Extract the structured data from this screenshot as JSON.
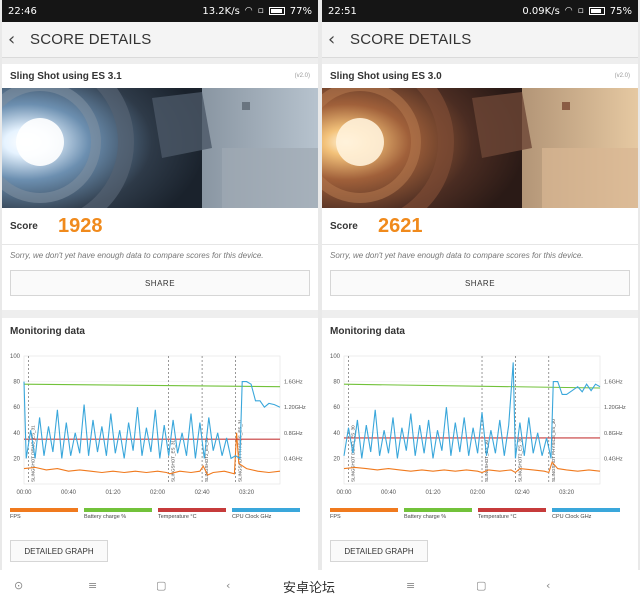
{
  "status_left": {
    "time": "22:46",
    "speed": "13.2K/s",
    "battery_pct": "77%",
    "battery_level": 0.77
  },
  "status_right": {
    "time": "22:51",
    "speed": "0.09K/s",
    "battery_pct": "75%",
    "battery_level": 0.75
  },
  "header": {
    "title": "SCORE DETAILS"
  },
  "panels": [
    {
      "test_name": "Sling Shot using ES 3.1",
      "version": "(v2.0)",
      "score_label": "Score",
      "score": "1928",
      "sorry_text": "Sorry, we don't yet have enough data to compare scores for this device.",
      "share_label": "SHARE",
      "monitoring_title": "Monitoring data",
      "detail_label": "DETAILED GRAPH",
      "phase_labels": [
        "SLINGSHOT DEMO_ES_31",
        "SLINGSHOT_ES_31",
        "SLINGSHOT2_ES_31",
        "SLINGSHOT PHYSICS_ES_31"
      ]
    },
    {
      "test_name": "Sling Shot using ES 3.0",
      "version": "(v2.0)",
      "score_label": "Score",
      "score": "2621",
      "sorry_text": "Sorry, we don't yet have enough data to compare scores for this device.",
      "share_label": "SHARE",
      "monitoring_title": "Monitoring data",
      "detail_label": "DETAILED GRAPH",
      "phase_labels": [
        "SLINGSHOT DEMO_ES_30",
        "SLINGSHOT_ES_30",
        "SLINGSHOT2_ES_30",
        "SLINGSHOT PHYSICS_ES_30"
      ]
    }
  ],
  "chart_data": [
    {
      "type": "line",
      "x_ticks": [
        "00:00",
        "00:40",
        "01:20",
        "02:00",
        "02:40",
        "03:20"
      ],
      "x_range_seconds": [
        0,
        230
      ],
      "y_left_ticks": [
        "100",
        "80",
        "60",
        "40",
        "20"
      ],
      "y_left_range": [
        0,
        100
      ],
      "y_right_ticks": [
        "1.6GHz",
        "1.20GHz",
        "0.8GHz",
        "0.4GHz"
      ],
      "phase_markers_seconds": [
        4,
        130,
        160,
        190
      ],
      "series": [
        {
          "name": "FPS",
          "color": "#f07a1e",
          "points": [
            [
              0,
              12
            ],
            [
              10,
              13
            ],
            [
              20,
              11
            ],
            [
              30,
              12
            ],
            [
              40,
              10
            ],
            [
              50,
              11
            ],
            [
              60,
              10
            ],
            [
              70,
              9
            ],
            [
              80,
              10
            ],
            [
              90,
              9
            ],
            [
              100,
              10
            ],
            [
              110,
              9
            ],
            [
              120,
              10
            ],
            [
              128,
              9
            ],
            [
              131,
              8
            ],
            [
              140,
              10
            ],
            [
              150,
              9
            ],
            [
              158,
              10
            ],
            [
              161,
              14
            ],
            [
              165,
              7
            ],
            [
              170,
              9
            ],
            [
              180,
              10
            ],
            [
              189,
              8
            ],
            [
              191,
              40
            ],
            [
              193,
              16
            ],
            [
              200,
              12
            ],
            [
              210,
              10
            ],
            [
              220,
              9
            ],
            [
              230,
              10
            ]
          ]
        },
        {
          "name": "Battery charge %",
          "color": "#72c23a",
          "points": [
            [
              0,
              78
            ],
            [
              230,
              76
            ]
          ]
        },
        {
          "name": "Temperature °C",
          "color": "#c63b3b",
          "points": [
            [
              0,
              35
            ],
            [
              230,
              35
            ]
          ]
        },
        {
          "name": "CPU Clock GHz",
          "color": "#3aa7db",
          "points": [
            [
              0,
              80
            ],
            [
              2,
              20
            ],
            [
              6,
              42
            ],
            [
              10,
              20
            ],
            [
              14,
              52
            ],
            [
              18,
              22
            ],
            [
              22,
              45
            ],
            [
              26,
              25
            ],
            [
              30,
              58
            ],
            [
              34,
              20
            ],
            [
              38,
              48
            ],
            [
              42,
              22
            ],
            [
              46,
              40
            ],
            [
              50,
              24
            ],
            [
              54,
              62
            ],
            [
              58,
              22
            ],
            [
              62,
              50
            ],
            [
              66,
              25
            ],
            [
              70,
              45
            ],
            [
              74,
              22
            ],
            [
              78,
              55
            ],
            [
              82,
              24
            ],
            [
              86,
              42
            ],
            [
              90,
              20
            ],
            [
              94,
              48
            ],
            [
              98,
              26
            ],
            [
              102,
              60
            ],
            [
              106,
              22
            ],
            [
              110,
              44
            ],
            [
              114,
              25
            ],
            [
              118,
              58
            ],
            [
              122,
              20
            ],
            [
              126,
              46
            ],
            [
              130,
              22
            ],
            [
              134,
              50
            ],
            [
              138,
              24
            ],
            [
              142,
              40
            ],
            [
              146,
              22
            ],
            [
              150,
              55
            ],
            [
              154,
              20
            ],
            [
              158,
              48
            ],
            [
              162,
              20
            ],
            [
              166,
              52
            ],
            [
              170,
              26
            ],
            [
              174,
              40
            ],
            [
              178,
              22
            ],
            [
              182,
              36
            ],
            [
              186,
              20
            ],
            [
              190,
              22
            ],
            [
              194,
              20
            ],
            [
              196,
              80
            ],
            [
              200,
              80
            ],
            [
              204,
              78
            ],
            [
              208,
              65
            ],
            [
              212,
              65
            ],
            [
              216,
              60
            ],
            [
              220,
              63
            ],
            [
              225,
              62
            ],
            [
              230,
              60
            ]
          ]
        }
      ]
    },
    {
      "type": "line",
      "x_ticks": [
        "00:00",
        "00:40",
        "01:20",
        "02:00",
        "02:40",
        "03:20"
      ],
      "x_range_seconds": [
        0,
        230
      ],
      "y_left_ticks": [
        "100",
        "80",
        "60",
        "40",
        "20"
      ],
      "y_left_range": [
        0,
        100
      ],
      "y_right_ticks": [
        "1.6GHz",
        "1.20GHz",
        "0.8GHz",
        "0.4GHz"
      ],
      "phase_markers_seconds": [
        4,
        124,
        154,
        184
      ],
      "series": [
        {
          "name": "FPS",
          "color": "#f07a1e",
          "points": [
            [
              0,
              12
            ],
            [
              10,
              13
            ],
            [
              20,
              12
            ],
            [
              30,
              11
            ],
            [
              40,
              12
            ],
            [
              50,
              11
            ],
            [
              60,
              10
            ],
            [
              70,
              11
            ],
            [
              80,
              10
            ],
            [
              90,
              11
            ],
            [
              100,
              10
            ],
            [
              110,
              11
            ],
            [
              120,
              10
            ],
            [
              124,
              9
            ],
            [
              130,
              11
            ],
            [
              140,
              10
            ],
            [
              150,
              11
            ],
            [
              154,
              9
            ],
            [
              158,
              12
            ],
            [
              170,
              11
            ],
            [
              180,
              10
            ],
            [
              184,
              9
            ],
            [
              187,
              17
            ],
            [
              192,
              12
            ],
            [
              200,
              11
            ],
            [
              210,
              10
            ],
            [
              220,
              11
            ],
            [
              230,
              10
            ]
          ]
        },
        {
          "name": "Battery charge %",
          "color": "#72c23a",
          "points": [
            [
              0,
              78
            ],
            [
              230,
              75
            ]
          ]
        },
        {
          "name": "Temperature °C",
          "color": "#c63b3b",
          "points": [
            [
              0,
              36
            ],
            [
              230,
              36
            ]
          ]
        },
        {
          "name": "CPU Clock GHz",
          "color": "#3aa7db",
          "points": [
            [
              0,
              22
            ],
            [
              4,
              44
            ],
            [
              8,
              24
            ],
            [
              12,
              50
            ],
            [
              16,
              20
            ],
            [
              20,
              46
            ],
            [
              24,
              25
            ],
            [
              28,
              58
            ],
            [
              32,
              22
            ],
            [
              36,
              42
            ],
            [
              40,
              24
            ],
            [
              44,
              52
            ],
            [
              48,
              20
            ],
            [
              52,
              44
            ],
            [
              56,
              26
            ],
            [
              60,
              55
            ],
            [
              64,
              22
            ],
            [
              68,
              46
            ],
            [
              72,
              24
            ],
            [
              76,
              50
            ],
            [
              80,
              20
            ],
            [
              84,
              42
            ],
            [
              88,
              26
            ],
            [
              92,
              60
            ],
            [
              96,
              22
            ],
            [
              100,
              48
            ],
            [
              104,
              25
            ],
            [
              108,
              52
            ],
            [
              112,
              22
            ],
            [
              116,
              44
            ],
            [
              120,
              24
            ],
            [
              124,
              56
            ],
            [
              128,
              22
            ],
            [
              132,
              42
            ],
            [
              136,
              24
            ],
            [
              140,
              50
            ],
            [
              144,
              22
            ],
            [
              148,
              46
            ],
            [
              152,
              95
            ],
            [
              154,
              20
            ],
            [
              158,
              48
            ],
            [
              162,
              22
            ],
            [
              166,
              52
            ],
            [
              170,
              24
            ],
            [
              174,
              40
            ],
            [
              178,
              22
            ],
            [
              182,
              36
            ],
            [
              186,
              20
            ],
            [
              188,
              80
            ],
            [
              192,
              80
            ],
            [
              196,
              70
            ],
            [
              200,
              70
            ],
            [
              205,
              73
            ],
            [
              210,
              76
            ],
            [
              214,
              72
            ],
            [
              218,
              78
            ],
            [
              222,
              73
            ],
            [
              226,
              78
            ],
            [
              230,
              76
            ]
          ]
        }
      ]
    }
  ],
  "nav": {
    "home_icon": "circle-icon",
    "menu_icon": "menu-icon",
    "square_icon": "square-icon",
    "back_icon": "back-icon"
  },
  "watermark": "安卓论坛"
}
